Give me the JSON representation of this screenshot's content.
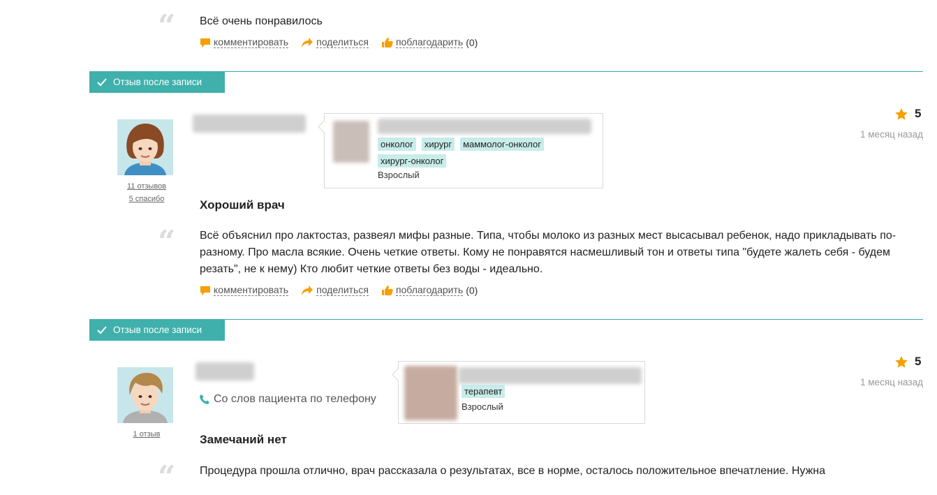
{
  "review0": {
    "text": "Всё очень понравилось",
    "actions": {
      "comment": "комментировать",
      "share": "поделиться",
      "thank": "поблагодарить",
      "thank_count": "(0)"
    }
  },
  "review1": {
    "badge": "Отзыв после записи",
    "user": {
      "reviews_link": "11 отзывов",
      "thanks_link": "5 спасибо"
    },
    "doctor": {
      "tags": [
        "онколог",
        "хирург",
        "маммолог-онколог",
        "хирург-онколог"
      ],
      "age_group": "Взрослый"
    },
    "rating": "5",
    "date": "1 месяц назад",
    "title": "Хороший врач",
    "text": "Всё объяснил про лактостаз, развеял мифы разные. Типа, чтобы молоко из разных мест высасывал ребенок, надо прикладывать по-разному. Про масла всякие. Очень четкие ответы. Кому не понравятся насмешливый тон и ответы типа \"будете жалеть себя - будем резать\", не к нему) Кто любит четкие ответы без воды - идеально.",
    "actions": {
      "comment": "комментировать",
      "share": "поделиться",
      "thank": "поблагодарить",
      "thank_count": "(0)"
    }
  },
  "review2": {
    "badge": "Отзыв после записи",
    "user": {
      "reviews_link": "1 отзыв"
    },
    "source": "Со слов пациента по телефону",
    "doctor": {
      "tags": [
        "терапевт"
      ],
      "age_group": "Взрослый"
    },
    "rating": "5",
    "date": "1 месяц назад",
    "title": "Замечаний нет",
    "text": "Процедура прошла отлично, врач рассказала о результатах, все в норме, осталось положительное впечатление. Нужна"
  },
  "colors": {
    "accent": "#3fb0ac",
    "star": "#f5a000",
    "action_icon": "#f5a000",
    "phone_icon": "#3fb0ac"
  }
}
